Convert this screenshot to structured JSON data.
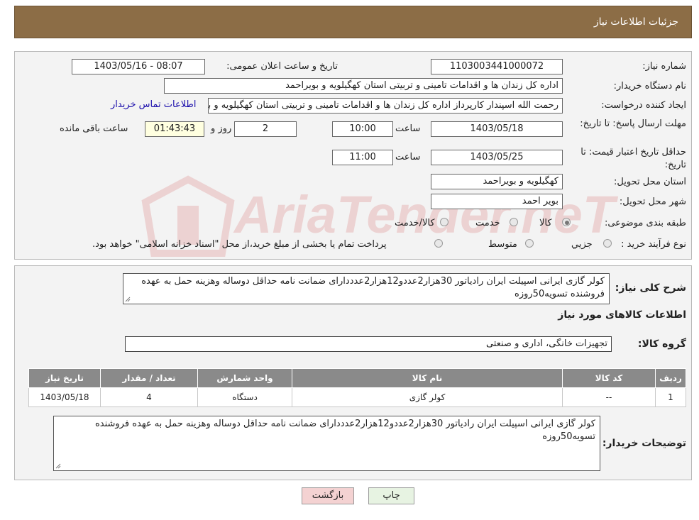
{
  "header": {
    "title": "جزئیات اطلاعات نیاز"
  },
  "form": {
    "need_number_label": "شماره نیاز:",
    "need_number": "1103003441000072",
    "announce_label": "تاریخ و ساعت اعلان عمومی:",
    "announce_value": "1403/05/16 - 08:07",
    "buyer_org_label": "نام دستگاه خریدار:",
    "buyer_org": "اداره کل زندان ها و اقدامات تامینی و تربیتی استان کهگیلویه و بویراحمد",
    "creator_label": "ایجاد کننده درخواست:",
    "creator": "رحمت الله اسپندار کارپرداز اداره کل زندان ها و اقدامات تامینی و تربیتی استان کهگیلویه و بویراحمد",
    "contact_link": "اطلاعات تماس خریدار",
    "reply_deadline_label": "مهلت ارسال پاسخ: تا تاریخ:",
    "reply_date": "1403/05/18",
    "time_label": "ساعت",
    "reply_time": "10:00",
    "days": "2",
    "days_label": "روز و",
    "remaining_time": "01:43:43",
    "remaining_label": "ساعت باقی مانده",
    "price_validity_label": "حداقل تاریخ اعتبار قیمت: تا تاریخ:",
    "price_date": "1403/05/25",
    "price_time": "11:00",
    "province_label": "استان محل تحویل:",
    "province": "کهگیلویه و بویراحمد",
    "city_label": "شهر محل تحویل:",
    "city": "بویر احمد",
    "category_label": "طبقه بندی موضوعی:",
    "category_options": [
      "کالا",
      "خدمت",
      "کالا/خدمت"
    ],
    "category_selected": "کالا",
    "purchase_type_label": "نوع فرآیند خرید :",
    "purchase_options": [
      "جزیي",
      "متوسط"
    ],
    "purchase_note": "پرداخت تمام یا بخشی از مبلغ خرید،از محل \"اسناد خزانه اسلامی\" خواهد بود."
  },
  "description": {
    "label": "شرح کلی نیاز:",
    "text": "کولر گازی ایرانی اسپیلت ایران رادیاتور 30هزار2عددو12هزار2عدددارای ضمانت نامه حداقل دوساله وهزینه حمل به عهده فروشنده تسویه50روزه"
  },
  "goods": {
    "section_title": "اطلاعات کالاهای مورد نیاز",
    "group_label": "گروه کالا:",
    "group_value": "تجهیزات خانگی، اداری و صنعتی",
    "table": {
      "headers": [
        "ردیف",
        "کد کالا",
        "نام کالا",
        "واحد شمارش",
        "تعداد / مقدار",
        "تاریخ نیاز"
      ],
      "rows": [
        [
          "1",
          "--",
          "کولر گازی",
          "دستگاه",
          "4",
          "1403/05/18"
        ]
      ]
    }
  },
  "buyer_notes": {
    "label": "توضیحات خریدار:",
    "text": "کولر گازی ایرانی اسپیلت ایران رادیاتور 30هزار2عددو12هزار2عدددارای ضمانت نامه حداقل دوساله وهزینه حمل به عهده فروشنده تسویه50روزه"
  },
  "buttons": {
    "print": "چاپ",
    "back": "بازگشت"
  },
  "watermark": {
    "text": "AriaTender.neT"
  },
  "colors": {
    "header": "#8c6d46",
    "back_button": "#f4d2d2",
    "print_button": "#e7f3e2",
    "table_header": "#8a8a8a"
  }
}
